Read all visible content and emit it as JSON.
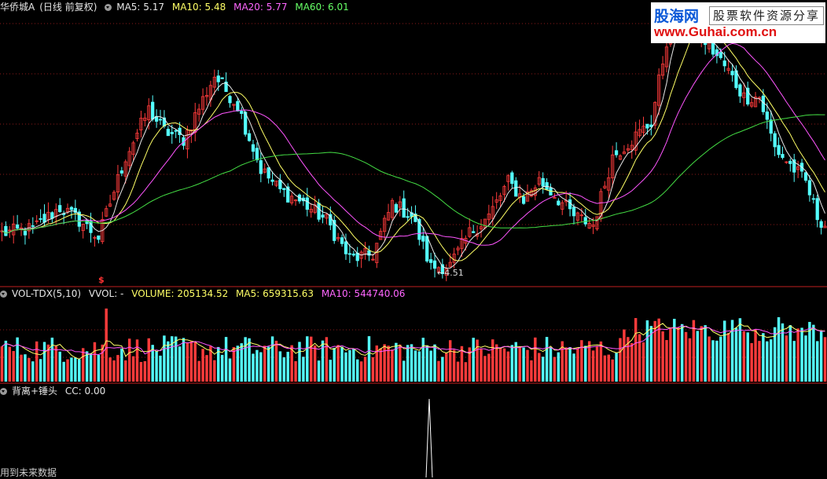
{
  "main": {
    "title": "华侨城A",
    "mode": "(日线 前复权)",
    "ma5": "MA5: 5.17",
    "ma10": "MA10: 5.48",
    "ma20": "MA20: 5.77",
    "ma60": "MA60: 6.01",
    "low_label": "←4.51",
    "signal_mark": "$"
  },
  "volume": {
    "title": "VOL-TDX(5,10)",
    "vvol": "VVOL: -",
    "volume": "VOLUME: 205134.52",
    "ma5": "MA5: 659315.63",
    "ma10": "MA10: 544740.06"
  },
  "indicator": {
    "title": "背离+锤头",
    "cc": "CC: 0.00",
    "note": "用到未来数据"
  },
  "watermark": {
    "brand": "股海网",
    "slogan": "股票软件资源分享",
    "url": "www.Guhai.com.cn"
  },
  "colors": {
    "up": "#ff3b3b",
    "down": "#54ffff",
    "ma5": "#e8e8e8",
    "ma10": "#ffff66",
    "ma20": "#ff55ff",
    "ma60": "#44dd44",
    "grid": "#8b1a1a"
  },
  "chart_data": [
    {
      "type": "candlestick",
      "ylim": [
        4.4,
        7.6
      ],
      "anchors": [
        [
          0,
          5.0
        ],
        [
          8,
          5.05
        ],
        [
          15,
          5.3
        ],
        [
          20,
          5.15
        ],
        [
          25,
          4.95
        ],
        [
          32,
          5.9
        ],
        [
          38,
          6.45
        ],
        [
          42,
          6.2
        ],
        [
          47,
          6.1
        ],
        [
          55,
          6.85
        ],
        [
          61,
          6.5
        ],
        [
          67,
          5.75
        ],
        [
          72,
          5.5
        ],
        [
          78,
          5.35
        ],
        [
          84,
          5.15
        ],
        [
          90,
          4.7
        ],
        [
          96,
          4.75
        ],
        [
          101,
          5.35
        ],
        [
          106,
          5.2
        ],
        [
          111,
          4.6
        ],
        [
          116,
          4.62
        ],
        [
          121,
          5.0
        ],
        [
          126,
          5.2
        ],
        [
          131,
          5.6
        ],
        [
          135,
          5.4
        ],
        [
          139,
          5.62
        ],
        [
          143,
          5.45
        ],
        [
          148,
          5.2
        ],
        [
          153,
          5.1
        ],
        [
          158,
          5.9
        ],
        [
          163,
          6.1
        ],
        [
          168,
          6.3
        ],
        [
          173,
          7.5
        ],
        [
          178,
          7.45
        ],
        [
          183,
          7.2
        ],
        [
          188,
          6.9
        ],
        [
          192,
          6.6
        ],
        [
          196,
          6.6
        ],
        [
          200,
          6.0
        ],
        [
          204,
          5.8
        ],
        [
          208,
          5.6
        ],
        [
          211,
          5.2
        ],
        [
          213,
          5.1
        ]
      ],
      "low": 4.51
    },
    {
      "type": "bar",
      "name": "volume"
    },
    {
      "type": "line",
      "name": "CC",
      "value": 0.0
    }
  ]
}
